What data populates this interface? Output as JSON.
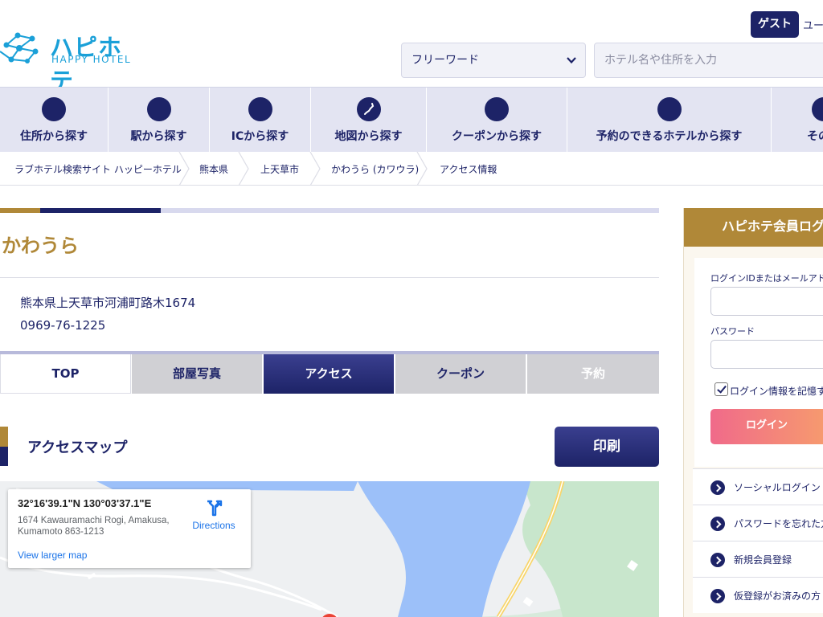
{
  "header": {
    "logo_text": "ハピホテ",
    "logo_sub": "HAPPY HOTEL",
    "guest_label": "ゲスト",
    "user_label": "ユー",
    "freeword_select": "フリーワード",
    "search_placeholder": "ホテル名や住所を入力"
  },
  "nav": {
    "items": [
      {
        "label": "住所から探す"
      },
      {
        "label": "駅から探す"
      },
      {
        "label": "ICから探す"
      },
      {
        "label": "地図から探す"
      },
      {
        "label": "クーポンから探す"
      },
      {
        "label": "予約のできるホテルから探す"
      },
      {
        "label": "その他"
      }
    ]
  },
  "breadcrumb": [
    "ラブホテル検索サイト ハッピーホテル",
    "熊本県",
    "上天草市",
    "かわうら (カワウラ)",
    "アクセス情報"
  ],
  "hotel": {
    "name": "かわうら",
    "address": "熊本県上天草市河浦町路木1674",
    "phone": "0969-76-1225"
  },
  "tabs": [
    {
      "label": "TOP"
    },
    {
      "label": "部屋写真"
    },
    {
      "label": "アクセス"
    },
    {
      "label": "クーポン"
    },
    {
      "label": "予約"
    }
  ],
  "access": {
    "title": "アクセスマップ",
    "print_label": "印刷"
  },
  "map": {
    "coords": "32°16'39.1\"N 130°03'37.1\"E",
    "address": "1674 Kawauramachi Rogi, Amakusa, Kumamoto 863-1213",
    "directions_label": "Directions",
    "larger_map_label": "View larger map"
  },
  "login": {
    "title": "ハピホテ会員ログ",
    "id_label": "ログインIDまたはメールアドレ",
    "password_label": "パスワード",
    "remember_label": "ログイン情報を記憶す",
    "login_button": "ログイン",
    "links": [
      {
        "label": "ソーシャルログイン"
      },
      {
        "label": "パスワードを忘れた方"
      },
      {
        "label": "新規会員登録"
      },
      {
        "label": "仮登録がお済みの方"
      }
    ]
  },
  "colors": {
    "navy": "#1d2367",
    "gold": "#b08838",
    "nav_bg": "#e3e4f2"
  }
}
